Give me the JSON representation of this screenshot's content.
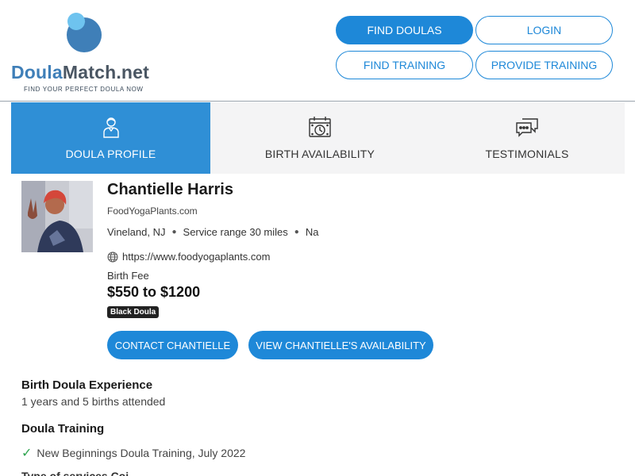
{
  "brand": {
    "name_part1": "Doula",
    "name_part2": "Match.net",
    "tagline": "FIND YOUR PERFECT DOULA NOW",
    "colors": {
      "primary": "#1e88d8",
      "logo_blue": "#3f7fb8",
      "logo_light": "#6ec3ef",
      "logo_gray": "#4a5663"
    }
  },
  "nav": {
    "find_doulas": "FIND DOULAS",
    "login": "LOGIN",
    "find_training": "FIND TRAINING",
    "provide_training": "PROVIDE TRAINING"
  },
  "tabs": [
    {
      "label": "DOULA PROFILE",
      "icon": "person-icon",
      "active": true
    },
    {
      "label": "BIRTH AVAILABILITY",
      "icon": "calendar-clock-icon",
      "active": false
    },
    {
      "label": "TESTIMONIALS",
      "icon": "chat-bubbles-icon",
      "active": false
    }
  ],
  "profile": {
    "name": "Chantielle Harris",
    "business": "FoodYogaPlants.com",
    "location": "Vineland, NJ",
    "service_range": "Service range 30 miles",
    "extra": "Na",
    "website": "https://www.foodyogaplants.com",
    "fee_label": "Birth Fee",
    "fee": "$550 to $1200",
    "badge": "Black Doula",
    "contact_button": "CONTACT CHANTIELLE",
    "availability_button": "VIEW CHANTIELLE'S AVAILABILITY"
  },
  "experience": {
    "title": "Birth Doula Experience",
    "text": "1 years and 5 births attended"
  },
  "training": {
    "title": "Doula Training",
    "items": [
      "New Beginnings Doula Training, July 2022"
    ]
  },
  "cutoff_text": "Type of services Coi..."
}
